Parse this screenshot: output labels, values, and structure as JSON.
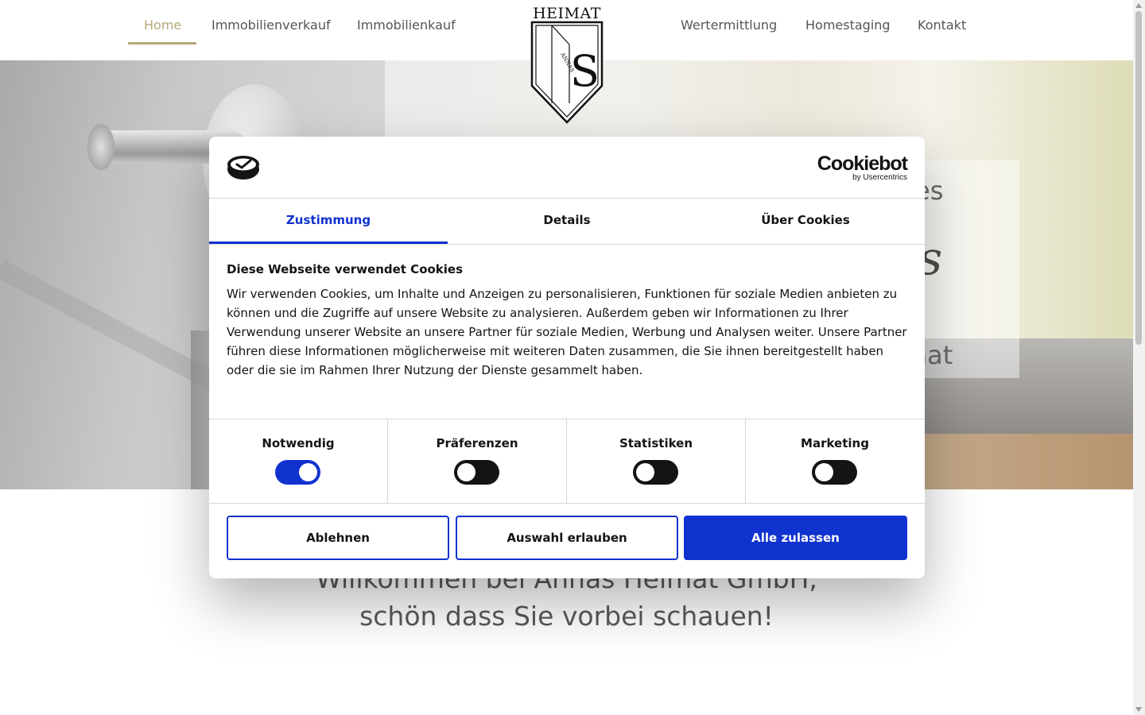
{
  "nav": {
    "left": [
      "Home",
      "Immobilienverkauf",
      "Immobilienkauf"
    ],
    "right": [
      "Wertermittlung",
      "Homestaging",
      "Kontakt"
    ],
    "active": "Home"
  },
  "logo": {
    "word": "HEIMAT",
    "small": "ANNAS",
    "letter": "S"
  },
  "hero": {
    "frag1": "es",
    "frag2": "us",
    "frag3": "mat"
  },
  "welcome": {
    "line1": "Willkommen bei Annas Heimat GmbH,",
    "line2": "schön dass Sie vorbei schauen!"
  },
  "dialog": {
    "brand": "Cookiebot",
    "brand_sub": "by Usercentrics",
    "tabs": [
      "Zustimmung",
      "Details",
      "Über Cookies"
    ],
    "active_tab": "Zustimmung",
    "title": "Diese Webseite verwendet Cookies",
    "text": "Wir verwenden Cookies, um Inhalte und Anzeigen zu personalisieren, Funktionen für soziale Medien anbieten zu können und die Zugriffe auf unsere Website zu analysieren. Außerdem geben wir Informationen zu Ihrer Verwendung unserer Website an unsere Partner für soziale Medien, Werbung und Analysen weiter. Unsere Partner führen diese Informationen möglicherweise mit weiteren Daten zusammen, die Sie ihnen bereitgestellt haben oder die sie im Rahmen Ihrer Nutzung der Dienste gesammelt haben.",
    "categories": [
      {
        "label": "Notwendig",
        "on": true
      },
      {
        "label": "Präferenzen",
        "on": false
      },
      {
        "label": "Statistiken",
        "on": false
      },
      {
        "label": "Marketing",
        "on": false
      }
    ],
    "buttons": {
      "decline": "Ablehnen",
      "allow_selection": "Auswahl erlauben",
      "allow_all": "Alle zulassen"
    }
  },
  "colors": {
    "accent": "#1032cf",
    "nav_active": "#b5a877",
    "toggle_off": "#141414"
  }
}
